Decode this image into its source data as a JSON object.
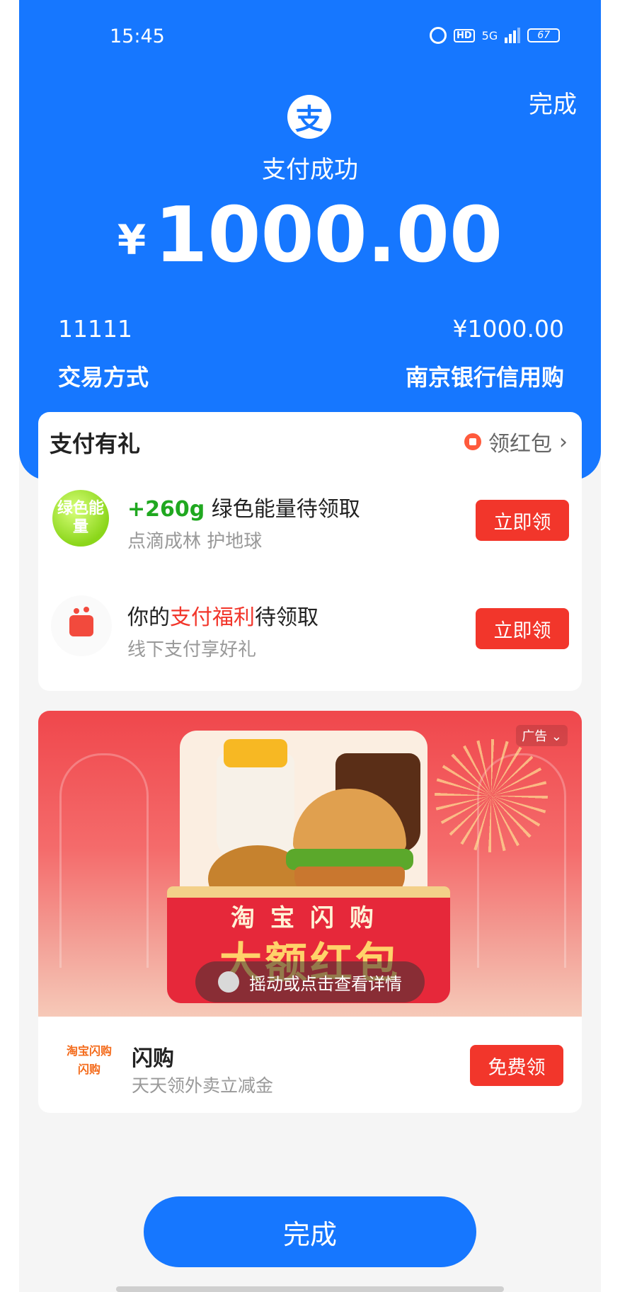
{
  "status_bar": {
    "time": "15:45",
    "hd": "HD",
    "network": "5G",
    "battery": "67"
  },
  "header": {
    "done_label": "完成",
    "logo_char": "支",
    "title": "支付成功"
  },
  "amount": {
    "currency": "¥",
    "value": "1000.00"
  },
  "details": {
    "merchant": "11111",
    "merchant_amount": "¥1000.00",
    "method_label": "交易方式",
    "method_value": "南京银行信用购"
  },
  "rewards": {
    "title": "支付有礼",
    "red_packet_link": "领红包",
    "items": [
      {
        "badge": "绿色能量",
        "title_highlight": "+260g",
        "title_rest": " 绿色能量待领取",
        "subtitle": "点滴成林 护地球",
        "button": "立即领"
      },
      {
        "title_prefix": "你的",
        "title_highlight": "支付福利",
        "title_rest": "待领取",
        "subtitle": "线下支付享好礼",
        "button": "立即领"
      }
    ]
  },
  "ad": {
    "tag": "广告",
    "banner_line1": "淘宝闪购",
    "banner_line2": "大额红包",
    "shake_text": "摇动或点击查看详情",
    "logo_line1": "淘宝闪购",
    "logo_line2": "闪购",
    "shop_name": "闪购",
    "shop_subtitle": "天天领外卖立减金",
    "button": "免费领"
  },
  "footer": {
    "done_label": "完成"
  },
  "colors": {
    "brand_blue": "#1677ff",
    "action_red": "#f2362b",
    "energy_green": "#20a820"
  }
}
